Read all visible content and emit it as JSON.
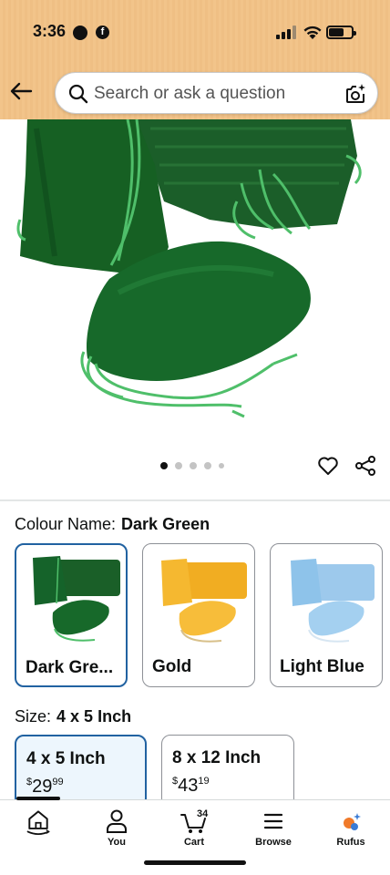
{
  "status_bar": {
    "time": "3:36"
  },
  "search": {
    "placeholder": "Search or ask a question"
  },
  "carousel": {
    "total": 5,
    "active": 1
  },
  "colour": {
    "label": "Colour Name:",
    "selected": "Dark Green",
    "options": [
      {
        "name": "Dark Gre...",
        "color": "#1f6b2e",
        "string": "#4fbf6a"
      },
      {
        "name": "Gold",
        "color": "#f2b632",
        "string": "#d8c08a"
      },
      {
        "name": "Light Blue",
        "color": "#8ec3ea",
        "string": "#d7e6f2"
      }
    ]
  },
  "size": {
    "label": "Size:",
    "selected": "4 x 5 Inch",
    "options": [
      {
        "name": "4 x 5 Inch",
        "price_symbol": "$",
        "price_whole": "29",
        "price_fraction": "99"
      },
      {
        "name": "8 x 12 Inch",
        "price_symbol": "$",
        "price_whole": "43",
        "price_fraction": "19"
      }
    ]
  },
  "bottom_nav": {
    "home": "",
    "you": "You",
    "cart": "Cart",
    "cart_count": "34",
    "browse": "Browse",
    "rufus": "Rufus"
  },
  "colors": {
    "accent_border": "#2162a1",
    "header_bg": "#f2c48a",
    "selected_bg": "#edf6fd"
  }
}
